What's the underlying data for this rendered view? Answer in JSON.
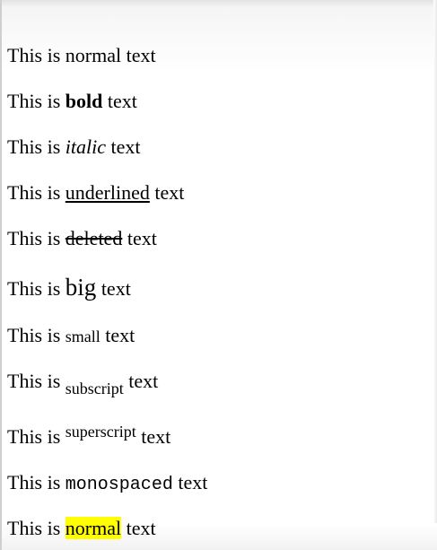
{
  "lines": [
    {
      "prefix": "This is ",
      "word": "normal",
      "suffix": " text",
      "style": "normal"
    },
    {
      "prefix": "This is ",
      "word": "bold",
      "suffix": " text",
      "style": "bold"
    },
    {
      "prefix": "This is ",
      "word": "italic",
      "suffix": " text",
      "style": "italic"
    },
    {
      "prefix": "This is ",
      "word": "underlined",
      "suffix": " text",
      "style": "underline"
    },
    {
      "prefix": "This is ",
      "word": "deleted",
      "suffix": " text",
      "style": "deleted"
    },
    {
      "prefix": "This is ",
      "word": "big",
      "suffix": " text",
      "style": "big"
    },
    {
      "prefix": "This is ",
      "word": "small",
      "suffix": " text",
      "style": "small"
    },
    {
      "prefix": "This is ",
      "word": "subscript",
      "suffix": " text",
      "style": "subscript"
    },
    {
      "prefix": "This is ",
      "word": "superscript",
      "suffix": " text",
      "style": "superscript"
    },
    {
      "prefix": "This is ",
      "word": "monospaced",
      "suffix": " text",
      "style": "monospaced"
    },
    {
      "prefix": "This is ",
      "word": "normal",
      "suffix": " text",
      "style": "highlighted"
    }
  ],
  "colors": {
    "highlight": "#ffff00",
    "text": "#000000",
    "background": "#ffffff"
  }
}
